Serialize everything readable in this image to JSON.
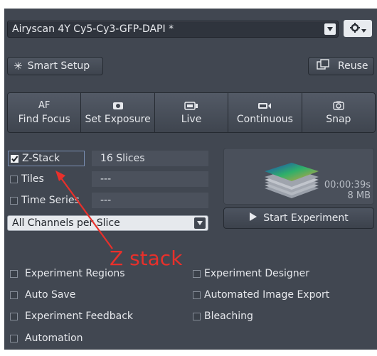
{
  "profile": {
    "name": "Airyscan 4Y Cy5-Cy3-GFP-DAPI *"
  },
  "buttons": {
    "smart_setup": "Smart Setup",
    "reuse": "Reuse"
  },
  "toolbar": [
    {
      "label": "Find Focus",
      "top": "AF",
      "icon": "af-icon"
    },
    {
      "label": "Set Exposure",
      "icon": "camera-icon"
    },
    {
      "label": "Live",
      "icon": "live-icon"
    },
    {
      "label": "Continuous",
      "icon": "continuous-icon"
    },
    {
      "label": "Snap",
      "icon": "snap-icon"
    }
  ],
  "dimensions": [
    {
      "label": "Z-Stack",
      "checked": true,
      "value": "16 Slices"
    },
    {
      "label": "Tiles",
      "checked": false,
      "value": "---"
    },
    {
      "label": "Time Series",
      "checked": false,
      "value": "---"
    }
  ],
  "channels_mode": "All Channels per Slice",
  "preview": {
    "duration": "00:00:39s",
    "size": "8 MB"
  },
  "start_experiment": "Start Experiment",
  "options": [
    {
      "label": "Experiment Regions",
      "checked": false
    },
    {
      "label": "Experiment Designer",
      "checked": false
    },
    {
      "label": "Auto Save",
      "checked": false
    },
    {
      "label": "Automated Image Export",
      "checked": false
    },
    {
      "label": "Experiment Feedback",
      "checked": false
    },
    {
      "label": "Bleaching",
      "checked": false
    },
    {
      "label": "Automation",
      "checked": false
    }
  ],
  "annotation": {
    "text": "Z stack",
    "color": "#e8302b"
  }
}
